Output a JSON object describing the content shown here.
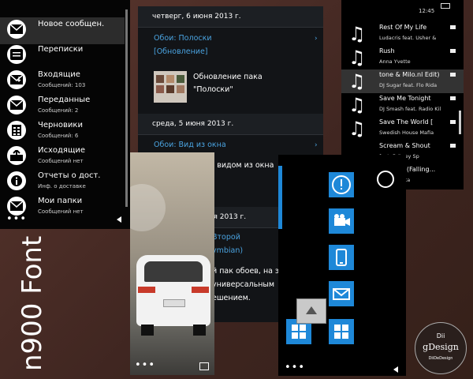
{
  "messaging": {
    "items": [
      {
        "title": "Новое сообщен.",
        "sub": "",
        "icon": "new-message-icon"
      },
      {
        "title": "Переписки",
        "sub": "",
        "icon": "conversations-icon"
      },
      {
        "title": "Входящие",
        "sub": "Сообщений: 103",
        "icon": "inbox-icon"
      },
      {
        "title": "Переданные",
        "sub": "Сообщений: 2",
        "icon": "sent-icon"
      },
      {
        "title": "Черновики",
        "sub": "Сообщений: 6",
        "icon": "drafts-icon"
      },
      {
        "title": "Исходящие",
        "sub": "Сообщений нет",
        "icon": "outbox-icon"
      },
      {
        "title": "Отчеты о дост.",
        "sub": "Инф. о доставке",
        "icon": "info-icon"
      },
      {
        "title": "Мои папки",
        "sub": "Сообщений нет",
        "icon": "folders-icon"
      }
    ],
    "more_label": "•••"
  },
  "calendar": {
    "day1": "четверг, 6 июня 2013 г.",
    "link1a": "Обои: Полоски",
    "link1b": "[Обновление]",
    "update_title": "Обновление пака",
    "update_name": "\"Полоски\"",
    "day2": "среда, 5 июня 2013 г.",
    "link2": "Обои: Вид из окна",
    "text2": "с видом из окна",
    "day3": "ая 2013 г.",
    "link3a": "Второй",
    "link3b": "ymbian)",
    "text3a": "й пак обоев, на этот",
    "text3b": "универсальным",
    "text3c": "ешением."
  },
  "music": {
    "clock": "12:45",
    "tracks": [
      {
        "title": "Rest Of My Life",
        "artist": "Ludacris feat. Usher &"
      },
      {
        "title": "Rush",
        "artist": "Anna Yvette"
      },
      {
        "title": "tone & Milo.nl Edit)",
        "artist": "DJ Sugar feat. Flo Rida"
      },
      {
        "title": "Save Me Tonight",
        "artist": "DJ Smash feat. Radio Kil"
      },
      {
        "title": "Save The World [",
        "artist": "Swedish House Mafia"
      },
      {
        "title": "Scream & Shout",
        "artist": "feat. Britney Sp"
      },
      {
        "title": "feat. (Falling...",
        "artist": "uetta"
      }
    ]
  },
  "launcher": {
    "more_label": "•••"
  },
  "car": {
    "more_label": "•••"
  },
  "brand": {
    "name": "n900 Font",
    "logo_top": "Dii",
    "logo_mid": "gDesign",
    "logo_bot": "DiiDeDesign"
  },
  "colors": {
    "accent": "#1e88d8",
    "link": "#4aa3e0",
    "background": "#4a2e28"
  }
}
